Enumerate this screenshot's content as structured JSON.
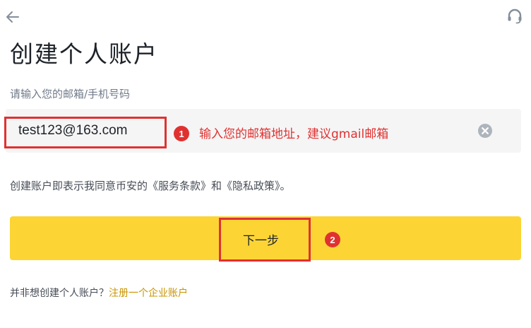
{
  "header": {
    "back_icon": "arrow-left-icon",
    "support_icon": "headset-icon"
  },
  "page": {
    "title": "创建个人账户",
    "field_label": "请输入您的邮箱/手机号码",
    "email_value": "test123@163.com",
    "clear_icon": "clear-circle-icon",
    "terms_text": "创建账户即表示我同意币安的《服务条款》和《隐私政策》。",
    "next_button_label": "下一步",
    "alt_prompt": "并非想创建个人账户？",
    "alt_link": "注册一个企业账户"
  },
  "annotations": {
    "step1_number": "1",
    "step1_text": "输入您的邮箱地址，建议gmail邮箱",
    "step2_number": "2",
    "color": "#e03131"
  },
  "colors": {
    "accent": "#fcd535",
    "link": "#c99400",
    "input_bg": "#f5f5f5"
  }
}
